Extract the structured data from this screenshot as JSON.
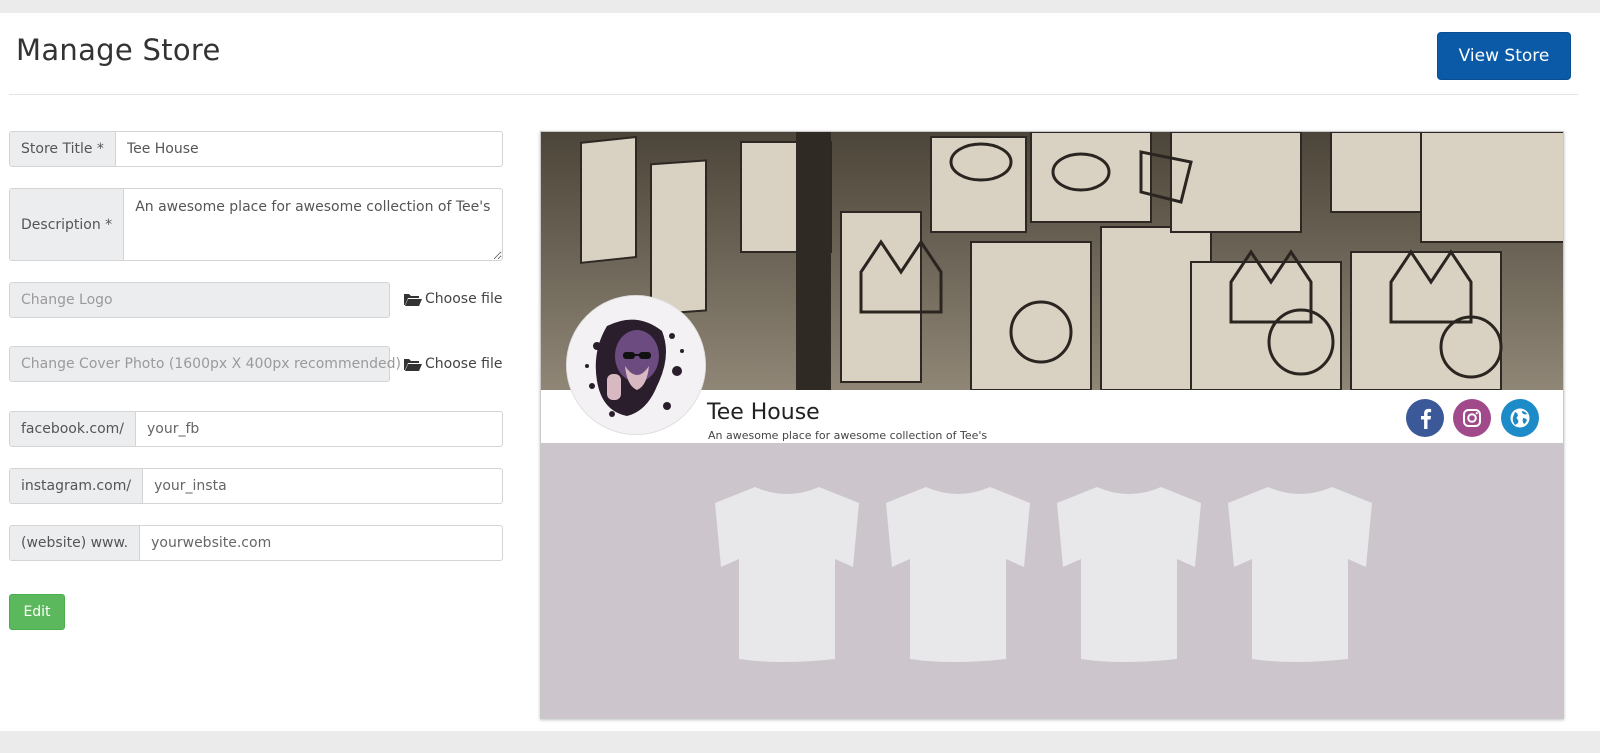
{
  "header": {
    "title": "Manage Store",
    "view_store_label": "View Store"
  },
  "form": {
    "store_title_label": "Store Title *",
    "store_title_value": "Tee House",
    "description_label": "Description *",
    "description_value": "An awesome place for awesome collection of Tee's",
    "logo_placeholder": "Change Logo",
    "cover_placeholder": "Change Cover Photo (1600px X 400px recommended)",
    "choose_file_label": "Choose file",
    "facebook_prefix": "facebook.com/",
    "facebook_placeholder": "your_fb",
    "instagram_prefix": "instagram.com/",
    "instagram_placeholder": "your_insta",
    "website_prefix": "(website) www.",
    "website_placeholder": "yourwebsite.com",
    "edit_label": "Edit"
  },
  "preview": {
    "store_name": "Tee House",
    "store_description": "An awesome place for awesome collection of Tee's",
    "social_icons": [
      "facebook-icon",
      "instagram-icon",
      "globe-icon"
    ],
    "product_placeholders": [
      "tshirt-icon",
      "tshirt-icon",
      "tshirt-icon",
      "tshirt-icon"
    ]
  },
  "colors": {
    "primary": "#0b5aa8",
    "success": "#5cb85c",
    "facebook": "#3b5998",
    "instagram": "#a04a8c",
    "website": "#1e8bc9",
    "product_area": "#ccc6cc"
  }
}
